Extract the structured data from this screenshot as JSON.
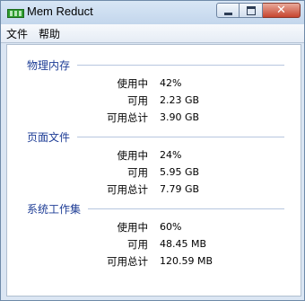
{
  "window": {
    "title": "Mem Reduct"
  },
  "menu": {
    "file": "文件",
    "help": "帮助"
  },
  "sections": [
    {
      "title": "物理内存",
      "rows": [
        {
          "label": "使用中",
          "value": "42%"
        },
        {
          "label": "可用",
          "value": "2.23 GB"
        },
        {
          "label": "可用总计",
          "value": "3.90 GB"
        }
      ]
    },
    {
      "title": "页面文件",
      "rows": [
        {
          "label": "使用中",
          "value": "24%"
        },
        {
          "label": "可用",
          "value": "5.95 GB"
        },
        {
          "label": "可用总计",
          "value": "7.79 GB"
        }
      ]
    },
    {
      "title": "系统工作集",
      "rows": [
        {
          "label": "使用中",
          "value": "60%"
        },
        {
          "label": "可用",
          "value": "48.45 MB"
        },
        {
          "label": "可用总计",
          "value": "120.59 MB"
        }
      ]
    }
  ],
  "colors": {
    "section_title": "#1e3d96",
    "close_button": "#c6452f",
    "app_icon": "#2f9c2f"
  },
  "icons": [
    "app-icon",
    "minimize-icon",
    "maximize-icon",
    "close-icon"
  ]
}
